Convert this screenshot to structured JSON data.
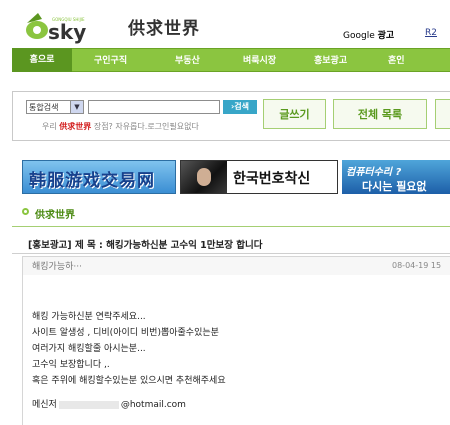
{
  "header": {
    "logo_text": "sky",
    "logo_tagline": "GONGQIU SHIJIE",
    "site_title": "供求世界",
    "google_prefix": "Google",
    "google_suffix": "광고",
    "r2_link": "R2"
  },
  "nav": {
    "items": [
      "홈으로",
      "구인구직",
      "부동산",
      "벼룩시장",
      "홍보광고",
      "혼인"
    ]
  },
  "search": {
    "select_value": "통합검색",
    "button_label": "›검색",
    "note_prefix": "우리",
    "note_brand": "供求世界",
    "note_suffix": "장점? 자유롭다.로그인필요없다"
  },
  "buttons": {
    "write": "글쓰기",
    "list": "전체 목록"
  },
  "banners": {
    "banner1_text": "韩服游戏交易网",
    "banner2_text": "한국번호착신",
    "banner3_line1": "컴퓨터수리 ?",
    "banner3_line2": "다시는 필요없"
  },
  "section": {
    "title": "供求世界"
  },
  "post": {
    "title": "[홍보광고] 제 목 : 해킹가능하신분 고수익 1만보장 합니다",
    "preview": "해킹가능하···",
    "date": "08-04-19 15",
    "body_lines": [
      "해킹 가능하신분 연락주세요...",
      "사이트 알생성 , 디비(아이디 비번)뽑아줄수있는분",
      "여러가지 해킹할줄 아시는분...",
      "고수익 보장합니다 ,.",
      "혹은 주위에 해킹할수있는분 있으시면 추천해주세요"
    ],
    "contact_label": "메신저",
    "contact_email": "@hotmail.com"
  },
  "colors": {
    "nav_green": "#8bc540",
    "nav_dark": "#5b9620",
    "accent_red": "#d21b1b",
    "search_blue": "#38a6c8"
  }
}
